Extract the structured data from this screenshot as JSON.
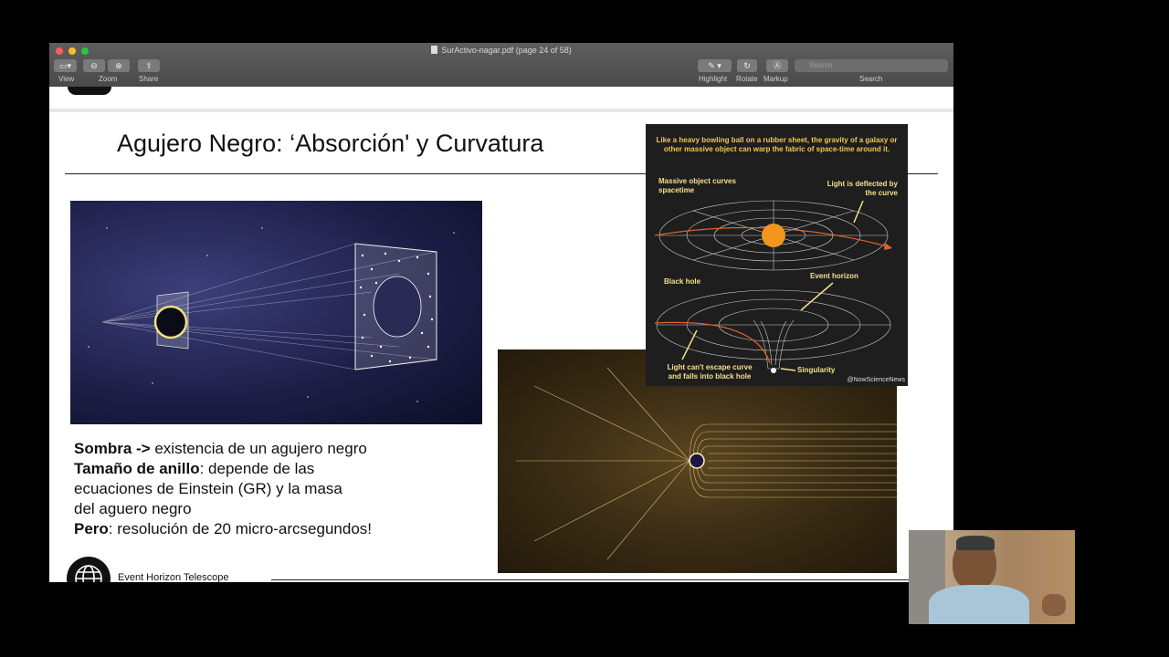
{
  "window": {
    "title": "SurActivo-nagar.pdf (page 24 of 58)",
    "toolbar": {
      "view_label": "View",
      "zoom_label": "Zoom",
      "share_label": "Share",
      "highlight_label": "Highlight",
      "rotate_label": "Rotate",
      "markup_label": "Markup",
      "search_label": "Search",
      "search_placeholder": "Search"
    },
    "colors": {
      "close": "#ff5f57",
      "minimize": "#febc2e",
      "zoom": "#28c840"
    }
  },
  "slide": {
    "title": "Agujero Negro: ‘Absorción' y Curvatura",
    "bullets": [
      {
        "bold": "Sombra ->",
        "text": " existencia de un agujero negro"
      },
      {
        "bold": "Tamaño de anillo",
        "text": ": depende de las"
      },
      {
        "bold": "",
        "text": "ecuaciones de Einstein (GR) y la masa"
      },
      {
        "bold": "",
        "text": "del aguero negro"
      },
      {
        "bold": "Pero",
        "text": ": resolución de 20 micro-arcsegundos!"
      }
    ],
    "footer_text": "Event Horizon Telescope",
    "diagram": {
      "caption": "Like a heavy bowling ball on a rubber sheet, the gravity of a galaxy or other massive object can warp the fabric of space-time around it.",
      "label_massive": "Massive object curves spacetime",
      "label_deflected": "Light is deflected by the curve",
      "label_black_hole": "Black hole",
      "label_event_horizon": "Event horizon",
      "label_cant_escape": "Light can't escape curve and falls into black hole",
      "label_singularity": "Singularity",
      "credit": "@NowScienceNews"
    }
  }
}
